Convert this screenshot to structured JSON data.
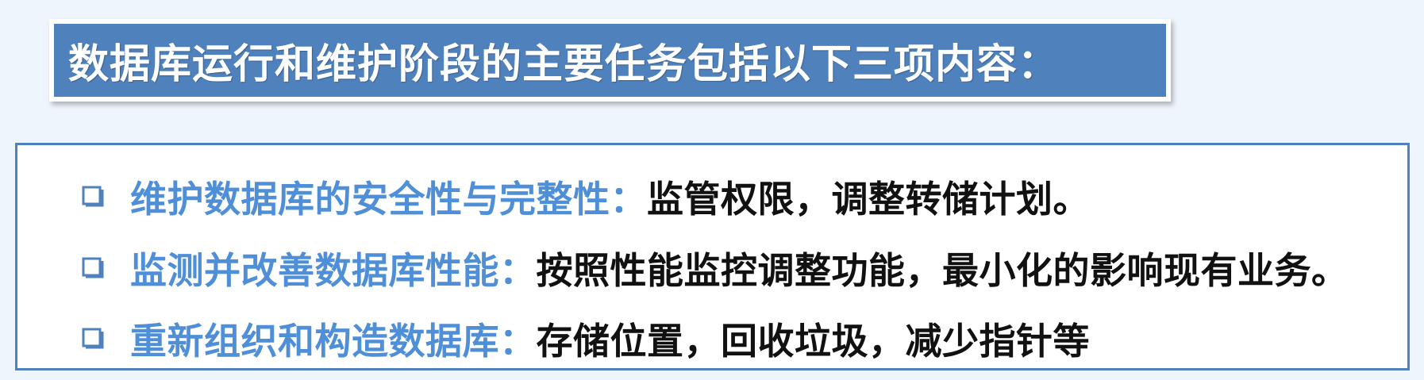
{
  "title": "数据库运行和维护阶段的主要任务包括以下三项内容：",
  "colors": {
    "title_background": "#4f81bd",
    "title_text": "#ffffff",
    "heading_text": "#4f8fd8",
    "detail_text": "#111111",
    "box_border": "#4f81bd",
    "page_background": "#eef5fc",
    "bullet": "#4f81bd"
  },
  "tasks": [
    {
      "icon": "square-bullet-icon",
      "heading": "维护数据库的安全性与完整性：",
      "detail": "监管权限，调整转储计划。"
    },
    {
      "icon": "square-bullet-icon",
      "heading": "监测并改善数据库性能：",
      "detail": "按照性能监控调整功能，最小化的影响现有业务。"
    },
    {
      "icon": "square-bullet-icon",
      "heading": "重新组织和构造数据库：",
      "detail": "存储位置，回收垃圾，减少指针等"
    }
  ]
}
